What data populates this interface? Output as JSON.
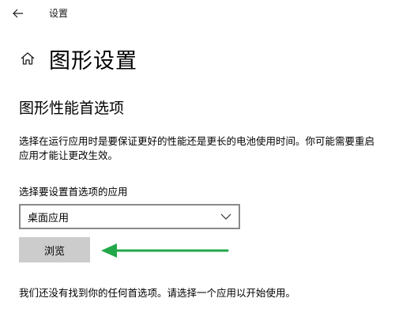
{
  "window": {
    "title": "设置"
  },
  "header": {
    "page_title": "图形设置"
  },
  "section": {
    "title": "图形性能首选项",
    "description": "选择在运行应用时是要保证更好的性能还是更长的电池使用时间。你可能需要重启应用才能让更改生效。"
  },
  "app_selector": {
    "label": "选择要设置首选项的应用",
    "selected_value": "桌面应用"
  },
  "browse_button": {
    "label": "浏览"
  },
  "empty_state": {
    "message": "我们还没有找到你的任何首选项。请选择一个应用以开始使用。"
  },
  "colors": {
    "arrow": "#22a84a",
    "button_bg": "#cccccc",
    "select_border": "#8a8a8a"
  },
  "icons": {
    "back": "back-arrow-icon",
    "home": "home-icon",
    "dropdown": "chevron-down-icon",
    "annotation": "green-arrow-icon"
  }
}
